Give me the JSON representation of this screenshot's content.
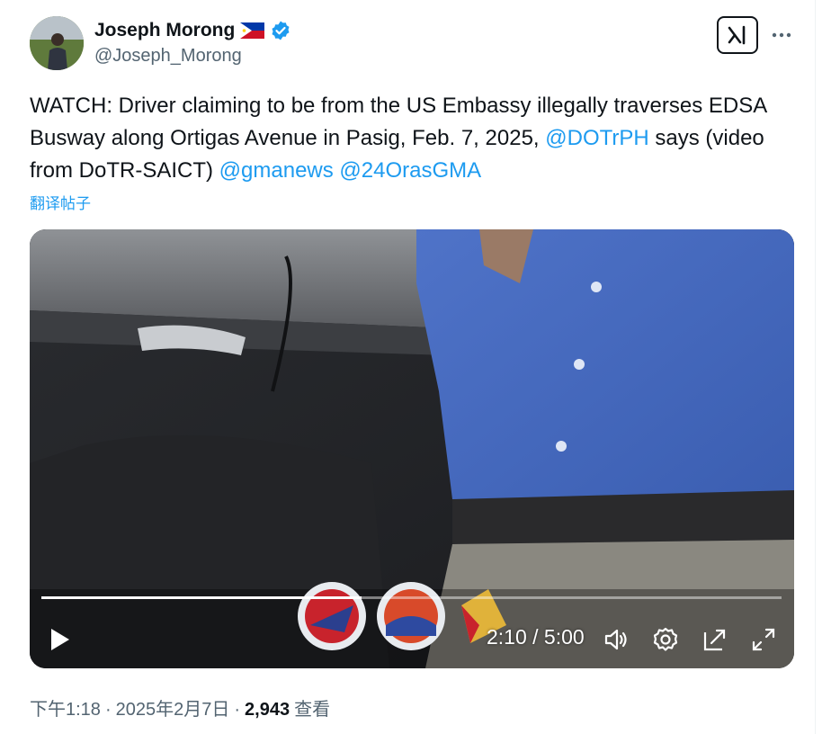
{
  "author": {
    "display_name": "Joseph Morong",
    "handle": "@Joseph_Morong",
    "flag_icon": "philippines-flag-icon",
    "verified_icon": "verified-badge-icon",
    "verified_color": "#1d9bf0"
  },
  "toolbar": {
    "grok_icon": "grok-icon",
    "more_icon": "more-icon"
  },
  "tweet": {
    "text_before": "WATCH: Driver claiming to be from the US Embassy illegally traverses EDSA Busway along Ortigas Avenue in Pasig, Feb. 7, 2025, ",
    "mention_1": "@DOTrPH",
    "text_middle": " says (video from DoTR-SAICT) ",
    "mention_2": "@gmanews",
    "text_space": " ",
    "mention_3": "@24OrasGMA",
    "translate_label": "翻译帖子",
    "link_color": "#1d9bf0"
  },
  "video": {
    "time_label": "2:10 / 5:00",
    "progress": 0.433,
    "controls": [
      "play-icon",
      "volume-icon",
      "settings-icon",
      "pip-icon",
      "fullscreen-icon"
    ]
  },
  "meta": {
    "time": "下午1:18",
    "separator": "·",
    "date": "2025年2月7日",
    "views_count": "2,943",
    "views_label": "查看"
  }
}
